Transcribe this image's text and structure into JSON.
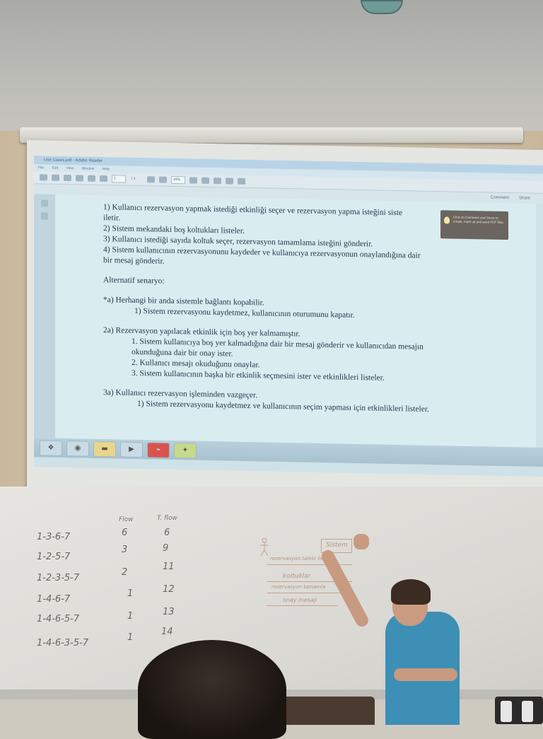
{
  "pdf_window": {
    "title": "Use Cases.pdf - Adobe Reader",
    "menu": [
      "File",
      "Edit",
      "View",
      "Window",
      "Help"
    ],
    "page_field": "1",
    "page_total": "/ 1",
    "zoom": "10%",
    "comment_label": "Comment",
    "share_label": "Share",
    "tooltip_text": "Click on Comment and Share to create, mark up and send PDF files."
  },
  "document": {
    "main_flow": [
      "1) Kullanıcı rezervasyon yapmak istediği etkinliği seçer ve rezervasyon yapma isteğini siste",
      "iletir.",
      "2) Sistem mekandaki boş koltukları listeler.",
      "3) Kullanıcı istediği sayıda koltuk seçer, rezervasyon tamamlama isteğini gönderir.",
      "4) Sistem kullanıcının rezervasyonunu kaydeder ve kullanıcıya rezervasyonun onaylandığına dair",
      "bir mesaj gönderir."
    ],
    "alt_heading": "Alternatif senaryo:",
    "alt_a_title": "*a) Herhangi bir anda sistemle bağlantı kopabilir.",
    "alt_a_steps": [
      "1) Sistem rezervasyonu kaydetmez, kullanıcının oturumunu kapatır."
    ],
    "alt_2a_title": "2a) Rezervasyon yapılacak etkinlik için boş yer kalmamıştır.",
    "alt_2a_steps": [
      "1. Sistem kullanıcıya boş yer kalmadığına dair bir mesaj gönderir ve kullanıcıdan mesajın",
      "okunduğuna dair bir onay ister.",
      "2. Kullanıcı mesajı okuduğunu onaylar.",
      "3. Sistem kullanıcının başka bir etkinlik seçmesini ister ve etkinlikleri listeler."
    ],
    "alt_3a_title": "3a)  Kullanıcı rezervasyon işleminden vazgeçer.",
    "alt_3a_steps": [
      "1) Sistem rezervasyonu kaydetmez ve kullanıcının seçim yapması için etkinlikleri listeler."
    ]
  },
  "whiteboard": {
    "column_headers": [
      "Flow",
      "T. flow"
    ],
    "rows": [
      {
        "path": "1-3-6-7",
        "flow": "6",
        "tflow": "6"
      },
      {
        "path": "1-2-5-7",
        "flow": "3",
        "tflow": "9"
      },
      {
        "path": "1-2-3-5-7",
        "flow": "2",
        "tflow": "11"
      },
      {
        "path": "1-4-6-7",
        "flow": "1",
        "tflow": "12"
      },
      {
        "path": "1-4-6-5-7",
        "flow": "1",
        "tflow": "13"
      },
      {
        "path": "1-4-6-3-5-7",
        "flow": "1",
        "tflow": "14"
      }
    ],
    "sequence_labels": [
      "Sistem",
      "rezervasyon talebi iletir",
      "koltuklar",
      "rezervasyon tamamla",
      "onay mesajı"
    ]
  },
  "icons": [
    "lightbulb-icon",
    "windows-start-icon",
    "chrome-icon",
    "folder-icon",
    "media-player-icon",
    "adobe-reader-icon",
    "app-icon"
  ]
}
